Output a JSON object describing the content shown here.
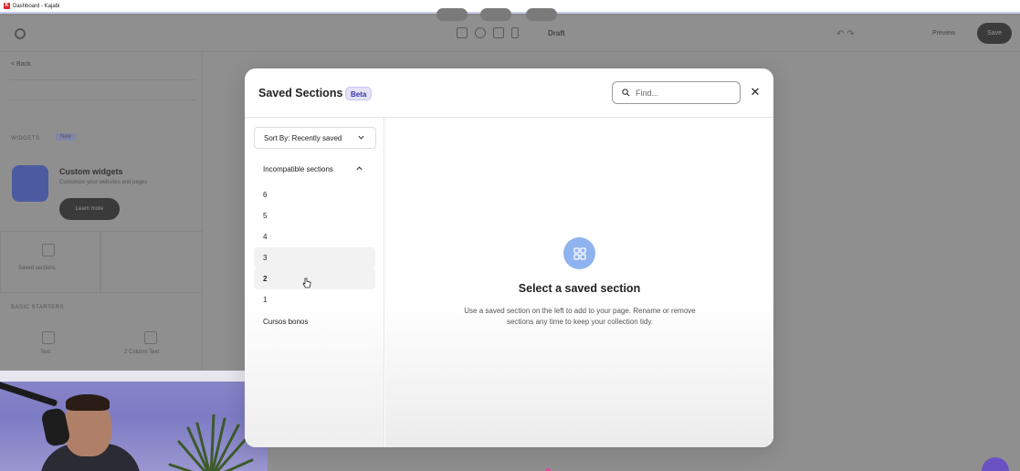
{
  "browser": {
    "tab_title": "Dashboard - Kajabi",
    "tab_logo_letter": "K"
  },
  "editor": {
    "draft_label": "Draft",
    "preview_label": "Preview",
    "save_label": "Save",
    "back_label": "< Back",
    "widgets_label": "WIDGETS",
    "new_badge": "New",
    "custom_widgets_title": "Custom widgets",
    "custom_widgets_sub": "Customize your websites and pages",
    "learn_more": "Learn more",
    "saved_sections_label": "Saved sections",
    "basic_label": "BASIC STARTERS",
    "basic_items": [
      "Text",
      "2 Column Text"
    ]
  },
  "modal": {
    "title": "Saved Sections",
    "beta_badge": "Beta",
    "search_placeholder": "Find...",
    "close_icon": "close-icon",
    "sort_label": "Sort By: Recently saved",
    "group_label": "Incompatible sections",
    "sections": [
      "6",
      "5",
      "4",
      "3",
      "2",
      "1",
      "Cursos bonos"
    ],
    "active_section": "2",
    "hovered_section": "3",
    "empty_title": "Select a saved section",
    "empty_description": "Use a saved section on the left to add to your page. Rename or remove sections any time to keep your collection tidy."
  },
  "colors": {
    "accent": "#8fb3ef",
    "beta_bg": "#e4e2f8",
    "beta_text": "#3a34a0",
    "overlay": "#8f8f8f"
  }
}
